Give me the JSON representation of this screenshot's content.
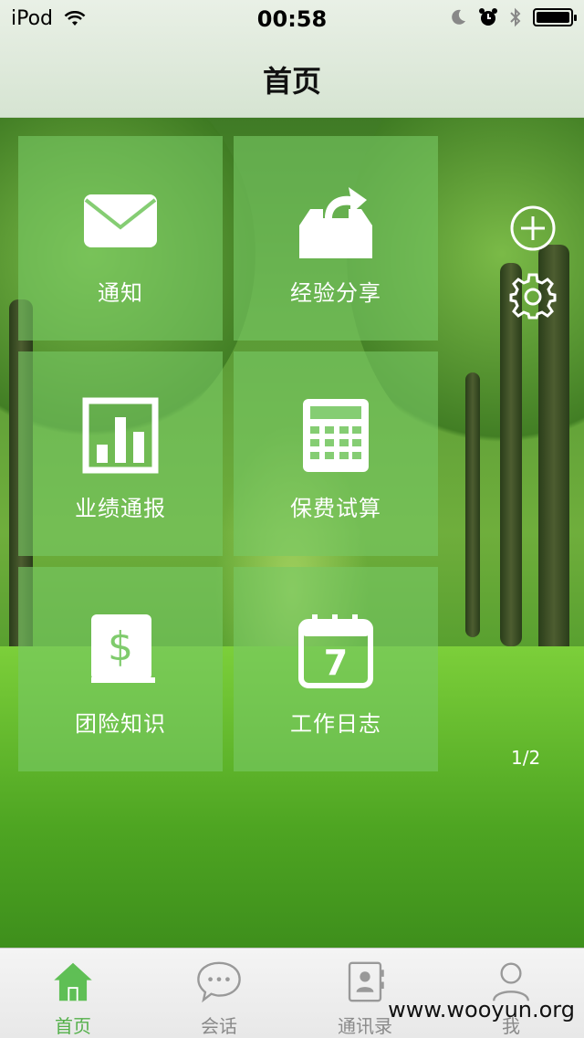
{
  "status_bar": {
    "carrier": "iPod",
    "time": "00:58",
    "icons": [
      "wifi-icon",
      "moon-icon",
      "alarm-icon",
      "bluetooth-icon",
      "battery-icon"
    ]
  },
  "header": {
    "title": "首页"
  },
  "tiles": [
    {
      "label": "通知",
      "icon": "envelope-icon"
    },
    {
      "label": "经验分享",
      "icon": "share-inbox-icon"
    },
    {
      "label": "业绩通报",
      "icon": "bar-chart-icon"
    },
    {
      "label": "保费试算",
      "icon": "calculator-icon"
    },
    {
      "label": "团险知识",
      "icon": "dollar-book-icon"
    },
    {
      "label": "工作日志",
      "icon": "calendar-icon"
    }
  ],
  "calendar_day": "7",
  "dollar_sign": "$",
  "side_actions": [
    "add-circle-icon",
    "gear-icon"
  ],
  "pager": "1/2",
  "tabbar": {
    "active": 0,
    "tabs": [
      {
        "label": "首页",
        "icon": "home-icon"
      },
      {
        "label": "会话",
        "icon": "chat-bubble-icon"
      },
      {
        "label": "通讯录",
        "icon": "contacts-icon"
      },
      {
        "label": "我",
        "icon": "person-icon"
      }
    ]
  },
  "watermark": "www.wooyun.org",
  "colors": {
    "accent": "#54b04a",
    "tile": "#78c864"
  }
}
